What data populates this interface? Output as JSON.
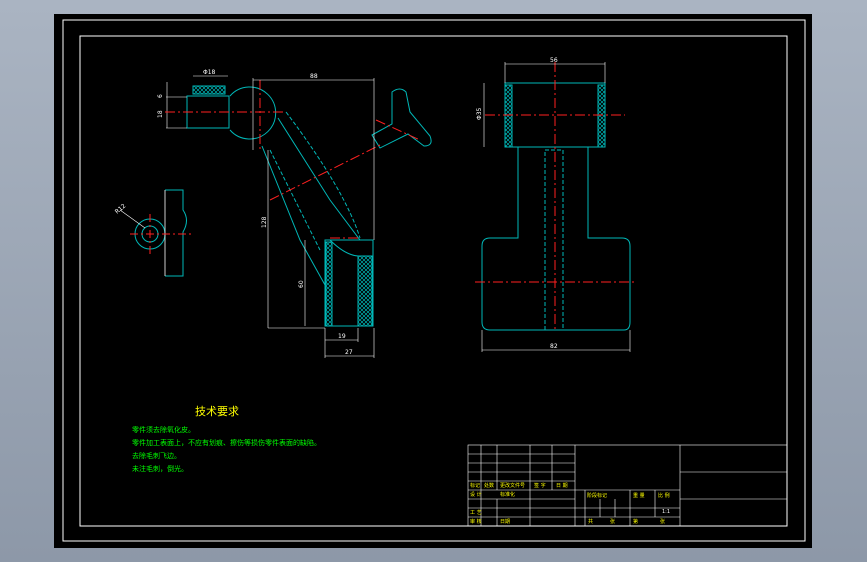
{
  "colors": {
    "line": "#ffffff",
    "part": "#00b7b7",
    "center": "#ff2020",
    "dim": "#ffffff",
    "hatch": "#00d0d0",
    "text": "#00ff00",
    "frame": "#ffffff",
    "yellow": "#ffff00"
  },
  "dimensions": {
    "d_phi18": "Φ18",
    "d_6": "6",
    "d_18": "18",
    "d_88": "88",
    "d_128": "128",
    "d_60": "60",
    "d_19": "19",
    "d_27": "27",
    "d_r12": "R12",
    "d_56": "56",
    "d_phi35": "Φ35",
    "d_82": "82"
  },
  "notes": {
    "title": "技术要求",
    "items": [
      "零件须去除氧化皮。",
      "零件加工表面上，不应有划痕、擦伤等损伤零件表面的缺陷。",
      "去除毛刺飞边。",
      "未注毛刺，倒光。"
    ]
  },
  "title_block": {
    "cells": [
      "标记",
      "处数",
      "更改文件号",
      "签 字",
      "日 期",
      "设 计",
      "标准化",
      "工 艺",
      "审 核",
      "批 准",
      "阶段标记",
      "重 量",
      "比 例",
      "1:1",
      "共",
      "张",
      "第",
      "张",
      "日期"
    ]
  }
}
